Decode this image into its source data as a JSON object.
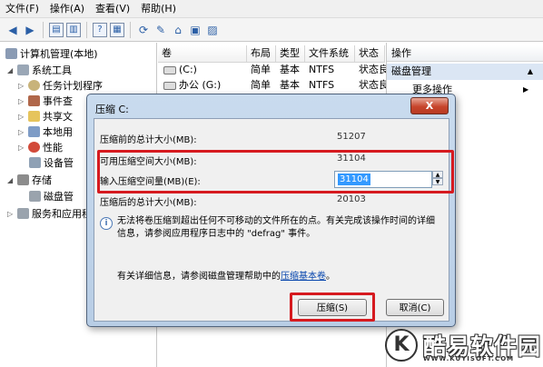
{
  "menubar": {
    "items": [
      "文件(F)",
      "操作(A)",
      "查看(V)",
      "帮助(H)"
    ]
  },
  "toolbar": {
    "icons": [
      "back-arrow-icon",
      "forward-arrow-icon",
      "up-folder-icon",
      "show-hide-tree-icon",
      "help-icon",
      "properties-icon",
      "refresh-icon",
      "export-icon",
      "connect-icon",
      "disk-icon",
      "settings-icon"
    ]
  },
  "tree": {
    "root": "计算机管理(本地)",
    "system_tools": "系统工具",
    "task_scheduler": "任务计划程序",
    "event_viewer": "事件查",
    "shared_folders": "共享文",
    "local_users": "本地用",
    "performance": "性能",
    "device_manager": "设备管",
    "storage": "存储",
    "disk_management": "磁盘管",
    "services": "服务和应用程"
  },
  "volume_list": {
    "headers": {
      "volume": "卷",
      "layout": "布局",
      "type": "类型",
      "filesystem": "文件系统",
      "status": "状态"
    },
    "rows": [
      {
        "volume": "(C:)",
        "layout": "简单",
        "type": "基本",
        "filesystem": "NTFS",
        "status": "状态良"
      },
      {
        "volume": "办公 (G:)",
        "layout": "简单",
        "type": "基本",
        "filesystem": "NTFS",
        "status": "状态良"
      }
    ]
  },
  "actions": {
    "header": "操作",
    "section": "磁盘管理",
    "more": "更多操作"
  },
  "dialog": {
    "title": "压缩 C:",
    "close": "X",
    "total_before_label": "压缩前的总计大小(MB):",
    "total_before_value": "51207",
    "available_label": "可用压缩空间大小(MB):",
    "available_value": "31104",
    "enter_label": "输入压缩空间量(MB)(E):",
    "enter_value": "31104",
    "total_after_label": "压缩后的总计大小(MB):",
    "total_after_value": "20103",
    "info_text": "无法将卷压缩到超出任何不可移动的文件所在的点。有关完成该操作时间的详细信息，请参阅应用程序日志中的 \"defrag\" 事件。",
    "help_prefix": "有关详细信息，请参阅磁盘管理帮助中的",
    "help_link": "压缩基本卷",
    "help_suffix": "。",
    "shrink_button": "压缩(S)",
    "cancel_button": "取消(C)"
  },
  "watermark": {
    "logo": "K",
    "text": "酷易软件园",
    "url": "WWW.KUYISOFT.COM"
  },
  "colors": {
    "highlight_box": "#d61a1f",
    "selection": "#3399ff",
    "dialog_frame": "#b8cde5"
  }
}
